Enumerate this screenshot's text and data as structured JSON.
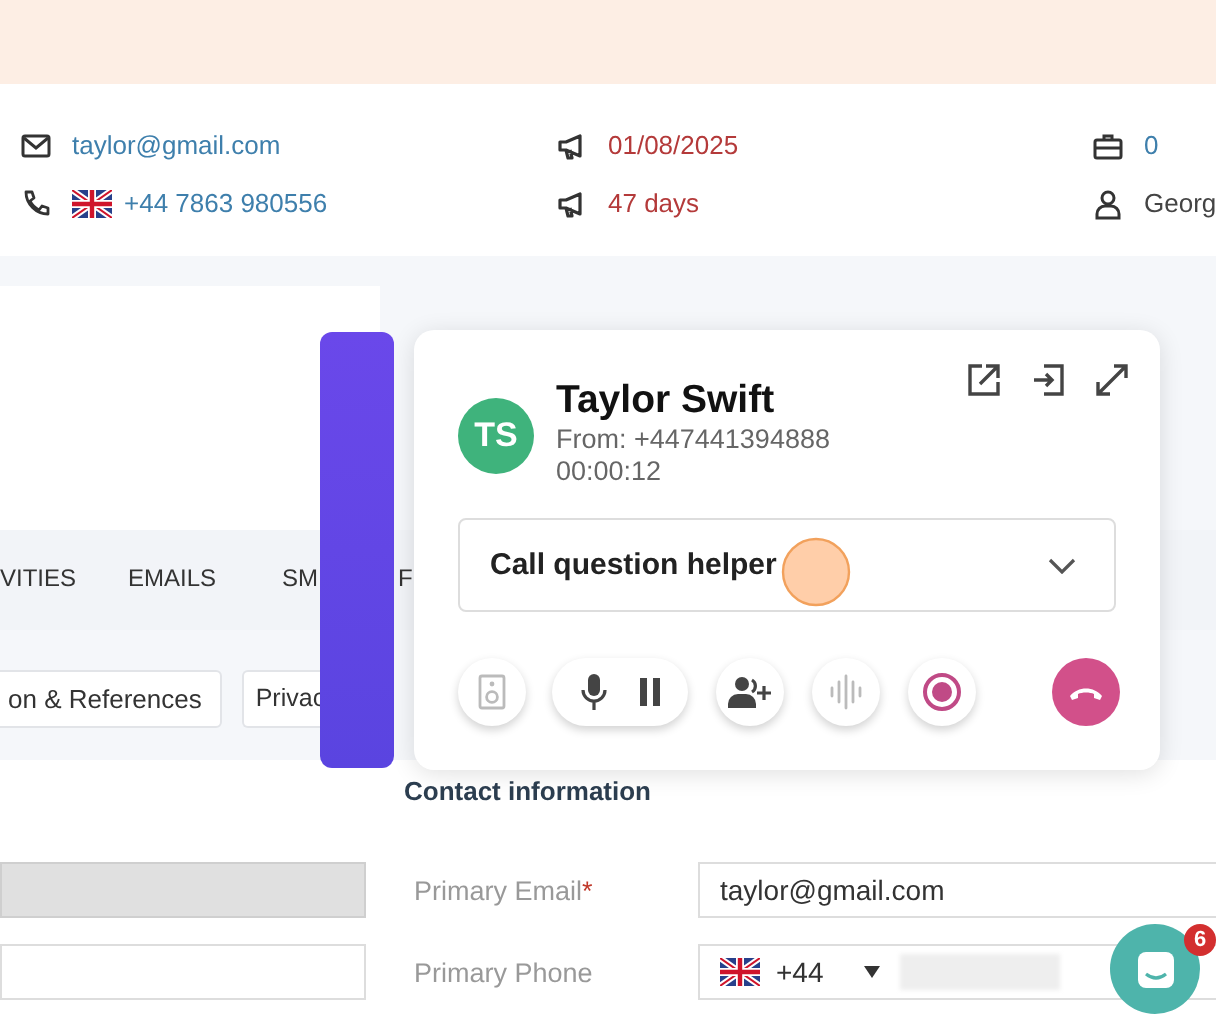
{
  "contact_summary": {
    "email": "taylor@gmail.com",
    "phone": "+44 7863 980556",
    "date": "01/08/2025",
    "days": "47 days",
    "deals": "0",
    "owner": "Georg"
  },
  "tabs": [
    {
      "label": "VITIES",
      "selected": false
    },
    {
      "label": "EMAILS",
      "selected": false
    },
    {
      "label": "SM",
      "selected": false
    },
    {
      "label": "F",
      "selected": false
    }
  ],
  "sub_tabs": [
    "on & References",
    "Privac"
  ],
  "contact_information": {
    "heading": "Contact information",
    "side_fields": [
      {
        "disabled": true
      },
      {
        "disabled": false
      }
    ],
    "fields": [
      {
        "kind": "text",
        "label": "Primary Email",
        "required_mark": "*",
        "value": "taylor@gmail.com"
      },
      {
        "kind": "phone",
        "label": "Primary Phone",
        "dial_code": "+44"
      }
    ]
  },
  "call": {
    "initials": "TS",
    "name": "Taylor Swift",
    "from": "From: +447441394888",
    "duration": "00:00:12",
    "helper": "Call question helper",
    "controls": [
      {
        "kind": "speaker",
        "disabled": true
      },
      {
        "kind": "mute_hold",
        "disabled": false
      },
      {
        "kind": "add_person",
        "disabled": false
      },
      {
        "kind": "audio",
        "disabled": true
      },
      {
        "kind": "record",
        "disabled": false
      },
      {
        "kind": "hangup",
        "disabled": false
      }
    ]
  },
  "chat": {
    "badge": "6"
  }
}
